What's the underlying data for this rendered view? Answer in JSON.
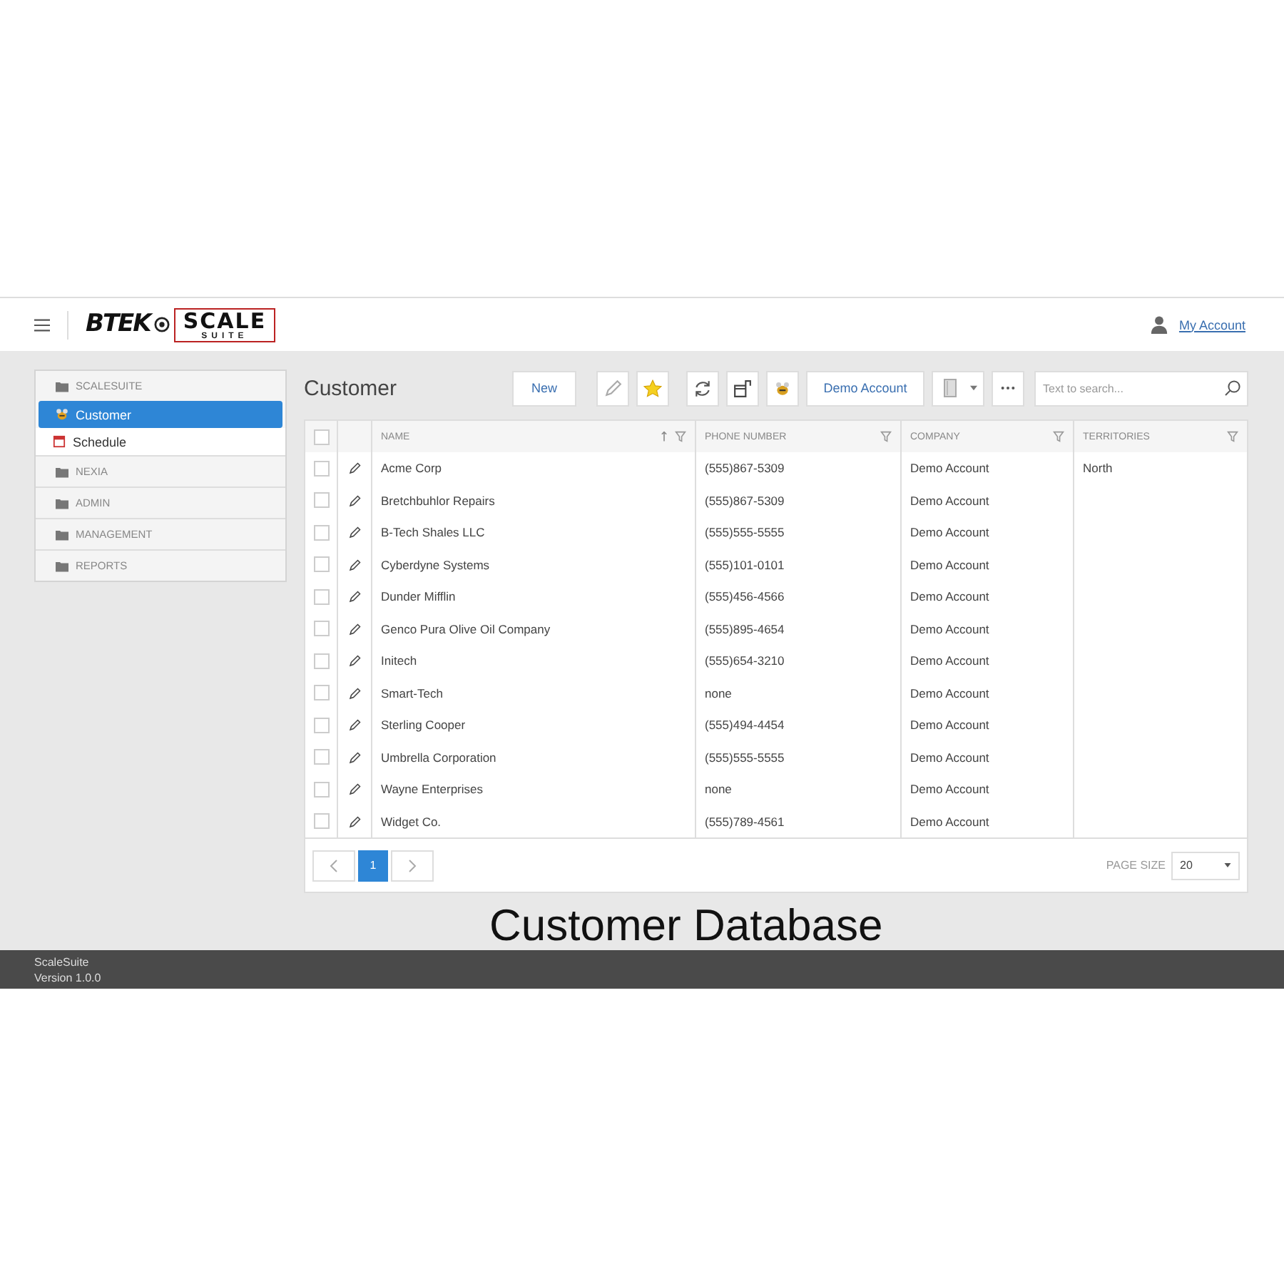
{
  "header": {
    "logo_left": "BTEK",
    "logo_main": "SCALE",
    "logo_sub": "SUITE",
    "account_link": "My Account"
  },
  "sidebar": {
    "groups": [
      {
        "label": "SCALESUITE",
        "items": [
          {
            "label": "Customer",
            "selected": true
          },
          {
            "label": "Schedule",
            "selected": false
          }
        ]
      },
      {
        "label": "NEXIA"
      },
      {
        "label": "ADMIN"
      },
      {
        "label": "MANAGEMENT"
      },
      {
        "label": "REPORTS"
      }
    ]
  },
  "page_title": "Customer",
  "toolbar": {
    "new_button": "New",
    "account_button": "Demo Account",
    "search": {
      "placeholder": "Text to search..."
    }
  },
  "table": {
    "select_all_checked": false,
    "columns": [
      {
        "label": "NAME",
        "sorted": true
      },
      {
        "label": "PHONE NUMBER",
        "sorted": false
      },
      {
        "label": "COMPANY",
        "sorted": false
      },
      {
        "label": "TERRITORIES",
        "sorted": false
      }
    ],
    "rows": [
      {
        "checked": false,
        "cells": [
          "Acme Corp",
          "(555)867-5309",
          "Demo Account",
          "North"
        ]
      },
      {
        "checked": false,
        "cells": [
          "Bretchbuhlor Repairs",
          "(555)867-5309",
          "Demo Account",
          ""
        ]
      },
      {
        "checked": false,
        "cells": [
          "B-Tech Shales LLC",
          "(555)555-5555",
          "Demo Account",
          ""
        ]
      },
      {
        "checked": false,
        "cells": [
          "Cyberdyne Systems",
          "(555)101-0101",
          "Demo Account",
          ""
        ]
      },
      {
        "checked": false,
        "cells": [
          "Dunder Mifflin",
          "(555)456-4566",
          "Demo Account",
          ""
        ]
      },
      {
        "checked": false,
        "cells": [
          "Genco Pura Olive Oil Company",
          "(555)895-4654",
          "Demo Account",
          ""
        ]
      },
      {
        "checked": false,
        "cells": [
          "Initech",
          "(555)654-3210",
          "Demo Account",
          ""
        ]
      },
      {
        "checked": false,
        "cells": [
          "Smart-Tech",
          "none",
          "Demo Account",
          ""
        ]
      },
      {
        "checked": false,
        "cells": [
          "Sterling Cooper",
          "(555)494-4454",
          "Demo Account",
          ""
        ]
      },
      {
        "checked": false,
        "cells": [
          "Umbrella Corporation",
          "(555)555-5555",
          "Demo Account",
          ""
        ]
      },
      {
        "checked": false,
        "cells": [
          "Wayne Enterprises",
          "none",
          "Demo Account",
          ""
        ]
      },
      {
        "checked": false,
        "cells": [
          "Widget Co.",
          "(555)789-4561",
          "Demo Account",
          ""
        ]
      }
    ]
  },
  "pager": {
    "pages": [
      {
        "label": "1",
        "selected": true
      }
    ],
    "page_size_label": "PAGE SIZE",
    "page_size": "20"
  },
  "caption": "Customer Database",
  "footer": {
    "app_name": "ScaleSuite",
    "version": "Version 1.0.0"
  }
}
